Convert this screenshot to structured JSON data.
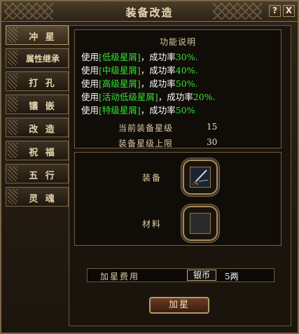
{
  "window": {
    "title": "装备改造",
    "help_label": "?",
    "close_label": "X"
  },
  "tabs": [
    {
      "label": "冲 星",
      "active": true
    },
    {
      "label": "属性继承"
    },
    {
      "label": "打 孔"
    },
    {
      "label": "镶 嵌"
    },
    {
      "label": "改 造"
    },
    {
      "label": "祝 福"
    },
    {
      "label": "五 行"
    },
    {
      "label": "灵 魂"
    }
  ],
  "description": {
    "title": "功能说明",
    "lines": [
      {
        "pre": "使用",
        "item": "[低级星屑]",
        "mid": "，成功率",
        "rate": "30%."
      },
      {
        "pre": "使用",
        "item": "[中级星屑]",
        "mid": "，成功率",
        "rate": "40%."
      },
      {
        "pre": "使用",
        "item": "[高级星屑]",
        "mid": "，成功率",
        "rate": "50%."
      },
      {
        "pre": "使用",
        "item": "[活动低级星屑]",
        "mid": "，成功率",
        "rate": "20%."
      },
      {
        "pre": "使用",
        "item": "[特级星屑]",
        "mid": "，成功率",
        "rate": "50%"
      }
    ],
    "current_star_label": "当前装备星级",
    "current_star_value": "15",
    "max_star_label": "装备星级上限",
    "max_star_value": "30"
  },
  "slots": {
    "equipment_label": "装备",
    "material_label": "材料"
  },
  "fee": {
    "label": "加星费用",
    "currency": "银币",
    "amount": "5两"
  },
  "action": {
    "button_label": "加星"
  },
  "colors": {
    "accent_green": "#31e531",
    "frame_gold": "#b49a6a"
  },
  "icons": {
    "equipment_item": "sword-icon"
  }
}
